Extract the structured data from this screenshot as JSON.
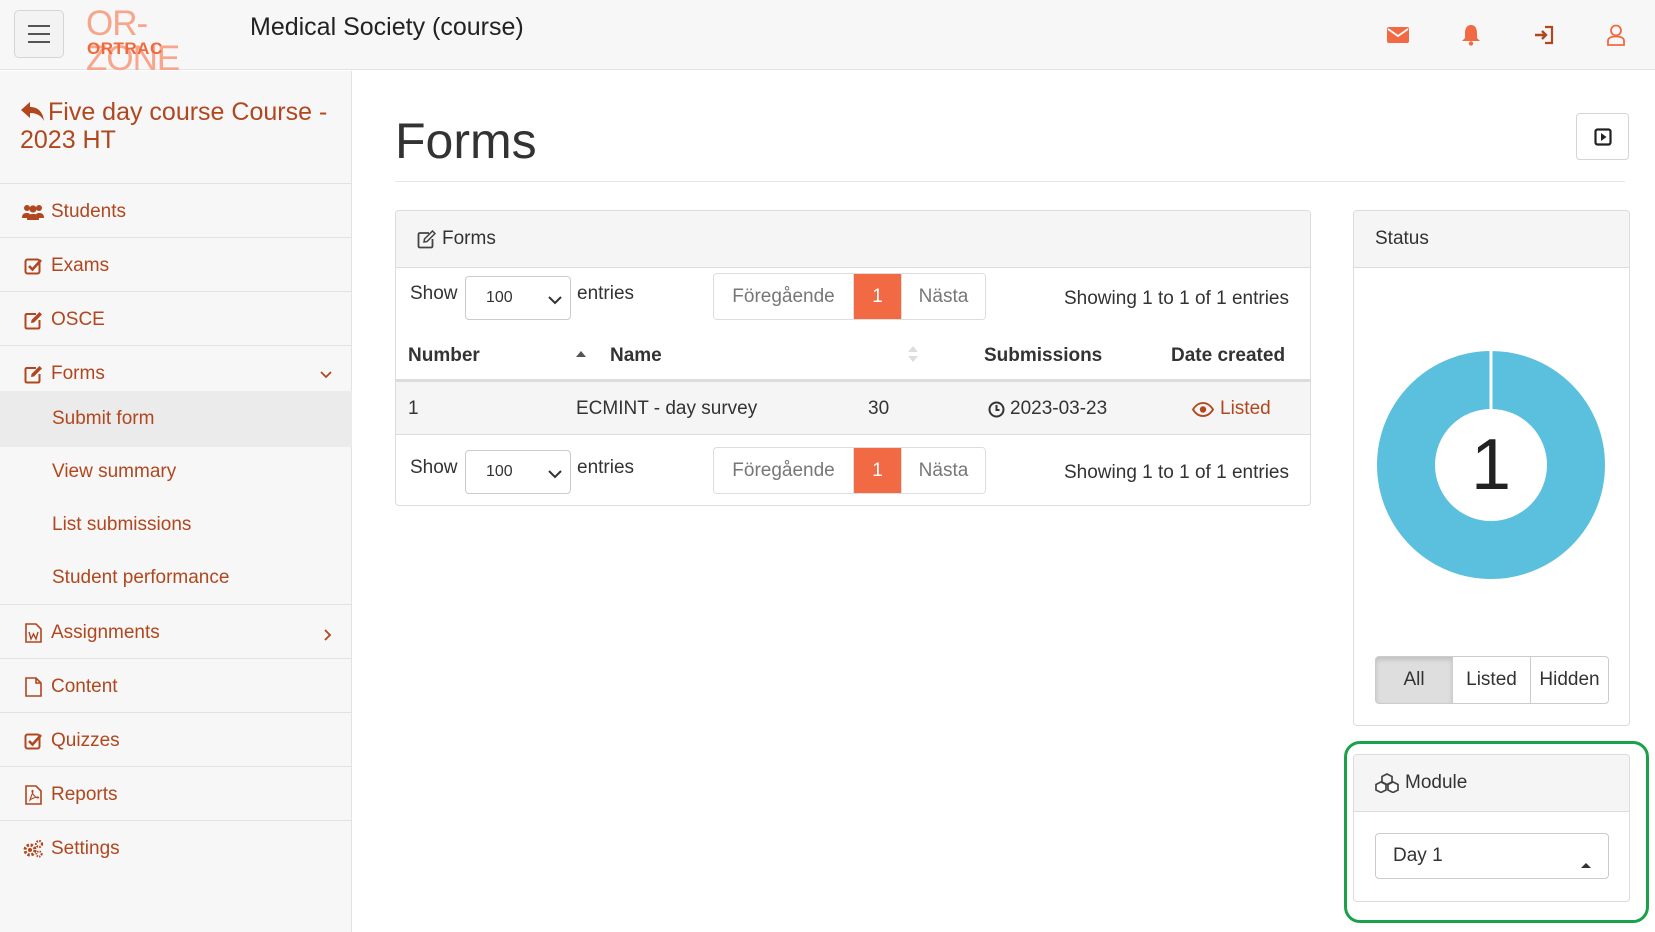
{
  "header": {
    "logo_top": "OR-ZONE",
    "logo_bottom": "ORTRAC",
    "title": "Medical Society (course)",
    "icons": [
      "envelope-icon",
      "bell-icon",
      "sign-in-icon",
      "user-icon"
    ]
  },
  "sidebar": {
    "course_title": "Five day course Course - 2023 HT",
    "items": [
      {
        "label": "Students",
        "icon": "users-icon"
      },
      {
        "label": "Exams",
        "icon": "check-square-icon"
      },
      {
        "label": "OSCE",
        "icon": "edit-icon"
      },
      {
        "label": "Forms",
        "icon": "edit-icon",
        "expanded": true
      },
      {
        "label": "Assignments",
        "icon": "word-file-icon"
      },
      {
        "label": "Content",
        "icon": "file-icon"
      },
      {
        "label": "Quizzes",
        "icon": "check-square-icon"
      },
      {
        "label": "Reports",
        "icon": "pdf-file-icon"
      },
      {
        "label": "Settings",
        "icon": "cogs-icon"
      }
    ],
    "subitems": [
      {
        "label": "Submit form",
        "active": true
      },
      {
        "label": "View summary"
      },
      {
        "label": "List submissions"
      },
      {
        "label": "Student performance"
      }
    ]
  },
  "main": {
    "page_title": "Forms",
    "forms_panel": {
      "title": "Forms",
      "show_label": "Show",
      "entries_value": "100",
      "entries_label": "entries",
      "prev_label": "Föregående",
      "current_page": "1",
      "next_label": "Nästa",
      "info": "Showing 1 to 1 of 1 entries",
      "columns": [
        "Number",
        "Name",
        "Submissions",
        "Date created"
      ],
      "rows": [
        {
          "number": "1",
          "name": "ECMINT - day survey",
          "submissions": "30",
          "date": "2023-03-23",
          "status": "Listed"
        }
      ]
    },
    "status_panel": {
      "title": "Status",
      "count": "1",
      "listed_fraction": 1.0,
      "accent": "#5bc0de",
      "filters": [
        "All",
        "Listed",
        "Hidden"
      ],
      "active_filter": "All"
    },
    "module_panel": {
      "title": "Module",
      "selected": "Day 1"
    }
  },
  "colors": {
    "accent": "#f26a43",
    "link": "#b0471f",
    "highlight": "#1aa14a"
  }
}
